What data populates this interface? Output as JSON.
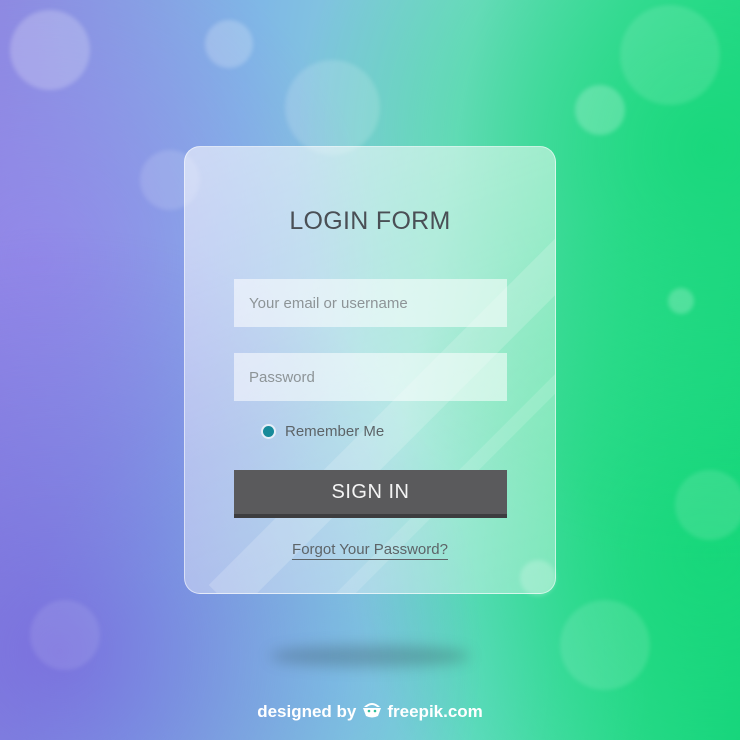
{
  "form": {
    "title": "LOGIN FORM",
    "email_placeholder": "Your email or username",
    "password_placeholder": "Password",
    "remember_label": "Remember Me",
    "signin_label": "SIGN IN",
    "forgot_label": "Forgot Your Password?"
  },
  "footer": {
    "prefix": "designed by",
    "brand": "freepik.com",
    "icon": "freepik-logo-icon"
  },
  "colors": {
    "button": "#5a5a5c",
    "radio_accent": "#178a9a",
    "title_text": "#4a4f55"
  }
}
